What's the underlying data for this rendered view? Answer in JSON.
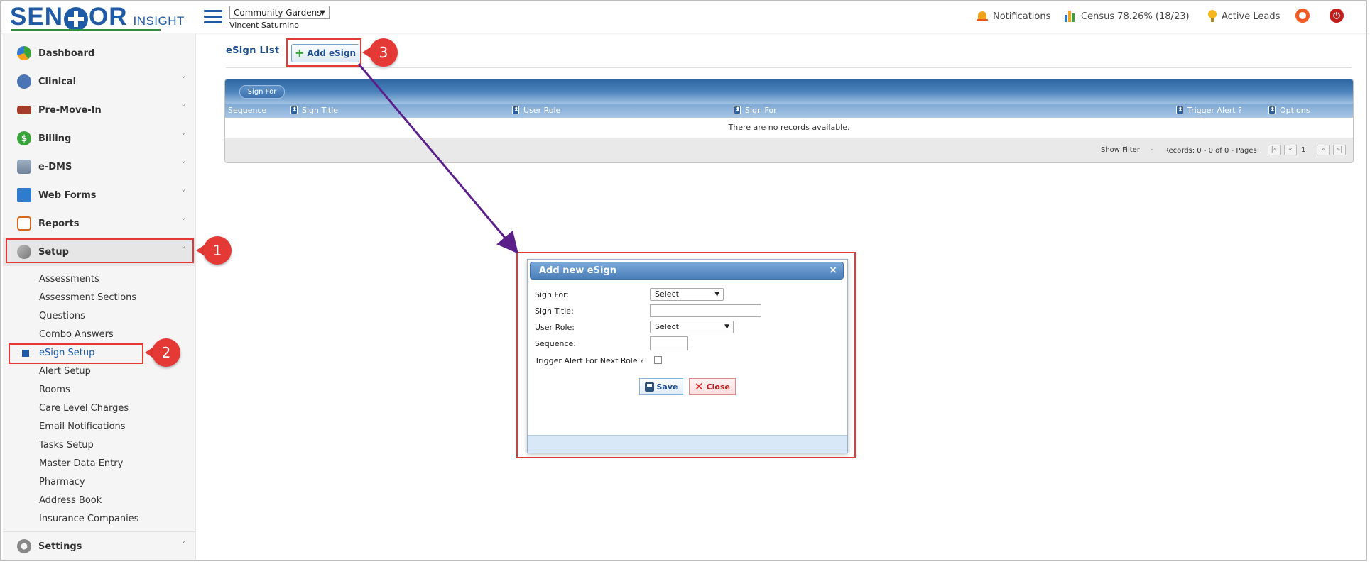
{
  "header": {
    "logo_main": "SENIOR",
    "logo_sub": "INSIGHT",
    "facility": "Community Gardens",
    "user": "Vincent Saturnino",
    "notifications": "Notifications",
    "census": "Census 78.26% (18/23)",
    "active_leads": "Active Leads"
  },
  "sidebar": {
    "nav": [
      {
        "label": "Dashboard",
        "color": "#3a9a3a"
      },
      {
        "label": "Clinical",
        "color": "#4a74b4"
      },
      {
        "label": "Pre-Move-In",
        "color": "#a43d2b"
      },
      {
        "label": "Billing",
        "color": "#3aa43a"
      },
      {
        "label": "e-DMS",
        "color": "#7a8fa8"
      },
      {
        "label": "Web Forms",
        "color": "#2f7ccf"
      },
      {
        "label": "Reports",
        "color": "#d2691e"
      },
      {
        "label": "Setup",
        "color": "#888888"
      }
    ],
    "setup_items": [
      "Assessments",
      "Assessment Sections",
      "Questions",
      "Combo Answers",
      "eSign Setup",
      "Alert Setup",
      "Rooms",
      "Care Level Charges",
      "Email Notifications",
      "Tasks Setup",
      "Master Data Entry",
      "Pharmacy",
      "Address Book",
      "Insurance Companies"
    ],
    "settings": "Settings"
  },
  "callouts": [
    "1",
    "2",
    "3"
  ],
  "main": {
    "title": "eSign List",
    "add_button": "Add eSign",
    "group_chip": "Sign For",
    "columns": [
      "Sequence",
      "Sign Title",
      "User Role",
      "Sign For",
      "Trigger Alert ?",
      "Options"
    ],
    "empty": "There are no records available.",
    "show_filter": "Show Filter",
    "dash": "-",
    "records": "Records: 0 - 0 of 0 - Pages:",
    "page": "1"
  },
  "dialog": {
    "title": "Add new eSign",
    "close": "×",
    "sign_for_label": "Sign For:",
    "sign_for_value": "Select",
    "sign_title_label": "Sign Title:",
    "user_role_label": "User Role:",
    "user_role_value": "Select",
    "sequence_label": "Sequence:",
    "trigger_label": "Trigger Alert For Next Role ?",
    "save": "Save",
    "close_btn": "Close"
  },
  "colors": {
    "brand": "#1f5aa6",
    "callout": "#e53935",
    "arrow": "#5b1f8a"
  }
}
